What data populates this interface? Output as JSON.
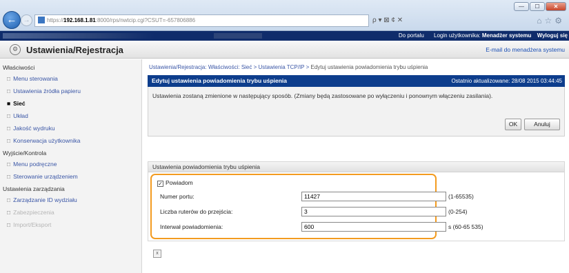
{
  "browser": {
    "address_prefix": "https://",
    "address_host": "192.168.1.81",
    "address_rest": ":8000/rps/nwtcip.cgi?CSUT=-657806886",
    "address_tools": "ρ ▾ ⊠ ¢ ✕",
    "window_buttons": [
      "—",
      "☐",
      "✕"
    ]
  },
  "userbar": {
    "portal_link": "Do portalu",
    "login_label": "Login użytkownika:",
    "login_value": "Menadżer systemu",
    "logout_link": "Wyloguj się"
  },
  "section": {
    "title": "Ustawienia/Rejestracja",
    "email_link": "E-mail do menadżera systemu"
  },
  "sidebar": {
    "groups": [
      {
        "label": "Właściwości",
        "items": [
          {
            "label": "Menu sterowania",
            "state": "normal"
          },
          {
            "label": "Ustawienia źródła papieru",
            "state": "normal"
          },
          {
            "label": "Sieć",
            "state": "active"
          },
          {
            "label": "Układ",
            "state": "normal"
          },
          {
            "label": "Jakość wydruku",
            "state": "normal"
          },
          {
            "label": "Konserwacja użytkownika",
            "state": "normal"
          }
        ]
      },
      {
        "label": "Wyjście/Kontrola",
        "items": [
          {
            "label": "Menu podręczne",
            "state": "normal"
          },
          {
            "label": "Sterowanie urządzeniem",
            "state": "normal"
          }
        ]
      },
      {
        "label": "Ustawienia zarządzania",
        "items": [
          {
            "label": "Zarządzanie ID wydziału",
            "state": "normal"
          },
          {
            "label": "Zabezpieczenia",
            "state": "faded"
          },
          {
            "label": "Import/Eksport",
            "state": "faded"
          }
        ]
      }
    ]
  },
  "main": {
    "breadcrumb": [
      "Ustawienia/Rejestracja: Właściwości: Sieć",
      "Ustawienia TCP/IP",
      "Edytuj ustawienia powiadomienia trybu uśpienia"
    ],
    "breadcrumb_separator": " > ",
    "panel_title": "Edytuj ustawienia powiadomienia trybu uśpienia",
    "last_updated": "Ostatnio aktualizowane: 28/08 2015 03:44:45",
    "info_text": "Ustawienia zostaną zmienione w następujący sposób. (Zmiany będą zastosowane po wyłączeniu i ponownym włączeniu zasilania).",
    "ok_label": "OK",
    "cancel_label": "Anuluj",
    "settings_header": "Ustawienia powiadomienia trybu uśpienia",
    "notify_checkbox": {
      "label": "Powiadom",
      "checked": true,
      "mark": "✓"
    },
    "fields": [
      {
        "label": "Numer portu:",
        "value": "11427",
        "range": "(1-65535)"
      },
      {
        "label": "Liczba ruterów do przejścia:",
        "value": "3",
        "range": "(0-254)"
      },
      {
        "label": "Interwał powiadomienia:",
        "value": "600",
        "range": "s (60-65 535)"
      }
    ],
    "footer_button": "x"
  },
  "colors": {
    "userbar_bg": "#0f2c6b",
    "panel_header_bg": "#0d3d8c",
    "link": "#3a56a6",
    "highlight": "#f39b1f"
  }
}
